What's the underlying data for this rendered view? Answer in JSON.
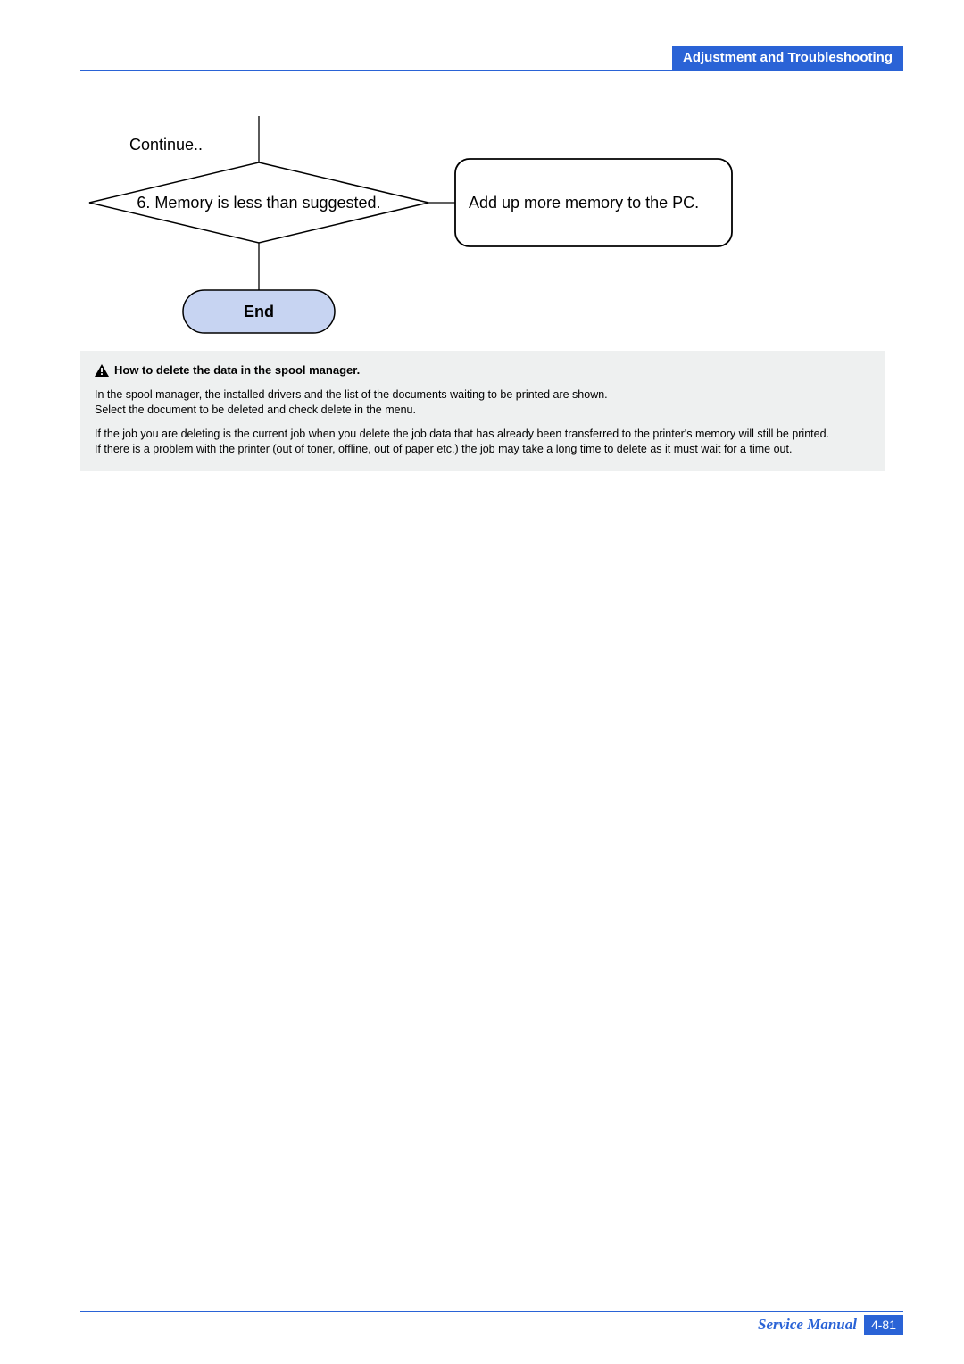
{
  "header": {
    "section_title": "Adjustment and Troubleshooting"
  },
  "flowchart": {
    "continue_label": "Continue..",
    "decision_text": "6. Memory is less than suggested.",
    "action_text": "Add up more memory to the PC.",
    "end_label": "End"
  },
  "info": {
    "title": "How to delete the data in the spool manager.",
    "para1_line1": "In the spool manager, the installed drivers and the list of the documents waiting to be printed are shown.",
    "para1_line2": "Select the document to be deleted and check delete in the menu.",
    "para2_line1": "If the job you are deleting is the current job when you delete the job data that has already been transferred to the printer's memory will still be printed.",
    "para2_line2": "If there is a problem with the printer (out of toner, offline, out of paper etc.) the job may take a long time to delete as it must wait for a time out."
  },
  "footer": {
    "label": "Service Manual",
    "page_number": "4-81"
  },
  "chart_data": {
    "type": "flowchart",
    "nodes": [
      {
        "id": "continue",
        "kind": "label",
        "text": "Continue.."
      },
      {
        "id": "decision",
        "kind": "decision",
        "text": "6. Memory is less than suggested."
      },
      {
        "id": "action",
        "kind": "process",
        "text": "Add up more memory to the PC."
      },
      {
        "id": "end",
        "kind": "terminator",
        "text": "End"
      }
    ],
    "edges": [
      {
        "from": "continue",
        "to": "decision"
      },
      {
        "from": "decision",
        "to": "action",
        "direction": "right"
      },
      {
        "from": "decision",
        "to": "end",
        "direction": "down"
      }
    ]
  }
}
